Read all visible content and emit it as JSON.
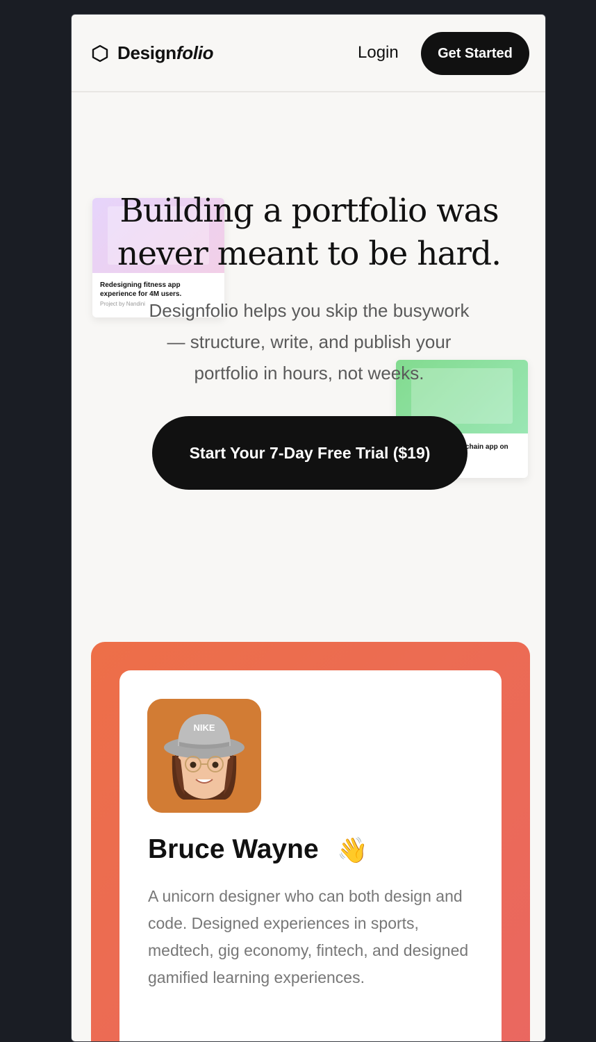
{
  "nav": {
    "logo_main": "Design",
    "logo_italic": "folio",
    "login": "Login",
    "get_started": "Get Started"
  },
  "hero": {
    "headline": "Building a portfolio was never meant to be hard.",
    "subtext": "Designfolio helps you skip the busywork — structure, write, and publish your portfolio in hours, not weeks.",
    "cta": "Start Your 7-Day Free Trial ($19)"
  },
  "floating_cards": [
    {
      "title": "Redesigning fitness app experience for 4M users.",
      "subtitle": "Project by Nandini",
      "colors": [
        "#e6d4fb",
        "#f2cfe7"
      ]
    },
    {
      "title": "chain app on",
      "subtitle": "",
      "colors": [
        "#82db8f",
        "#9ae6b4"
      ]
    }
  ],
  "profile": {
    "name": "Bruce Wayne",
    "wave_emoji": "👋",
    "bio": "A unicorn designer who can both design and code. Designed experiences in sports, medtech, gig economy, fintech, and designed gamified learning experiences.",
    "avatar_hat_text": "NIKE"
  },
  "colors": {
    "background": "#1a1d24",
    "page": "#f8f7f5",
    "button_dark": "#111111",
    "profile_accent": "#ed6f48",
    "avatar_bg": "#d27c34"
  }
}
